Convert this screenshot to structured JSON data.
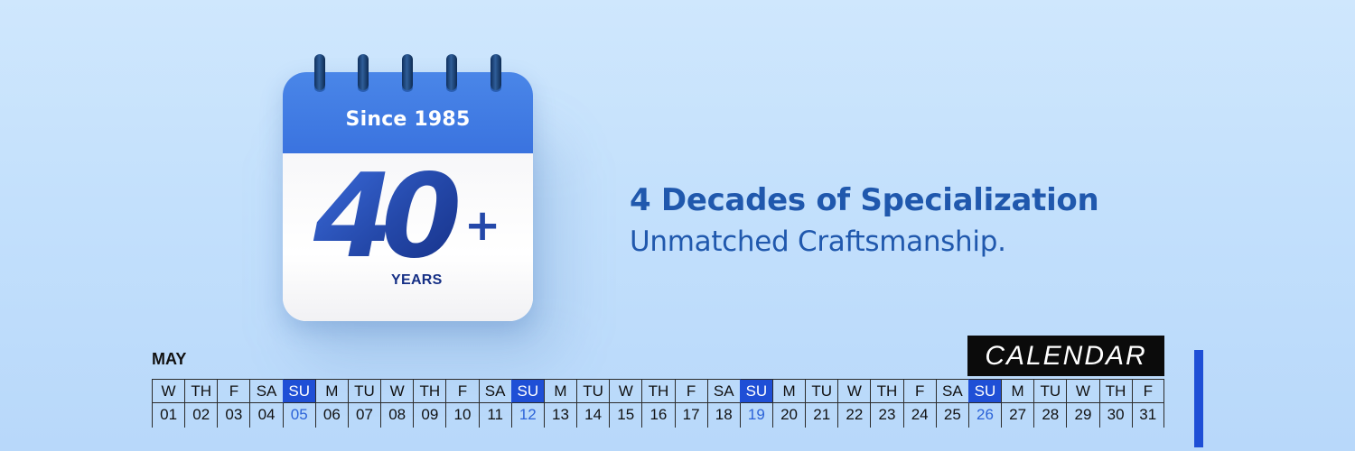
{
  "calendar_graphic": {
    "since_label": "Since 1985",
    "big_number": "40",
    "plus_sign": "+",
    "years_label": "YEARS",
    "ring_icon": "binder-ring-icon",
    "colors": {
      "header": "#3a73df",
      "number": "#2448a9"
    }
  },
  "headline": {
    "title": "4 Decades of Specialization",
    "subtitle": "Unmatched Craftsmanship."
  },
  "calendar_strip": {
    "month": "MAY",
    "badge": "CALENDAR",
    "days": [
      {
        "day": "W",
        "date": "01",
        "sunday": false
      },
      {
        "day": "TH",
        "date": "02",
        "sunday": false
      },
      {
        "day": "F",
        "date": "03",
        "sunday": false
      },
      {
        "day": "SA",
        "date": "04",
        "sunday": false
      },
      {
        "day": "SU",
        "date": "05",
        "sunday": true
      },
      {
        "day": "M",
        "date": "06",
        "sunday": false
      },
      {
        "day": "TU",
        "date": "07",
        "sunday": false
      },
      {
        "day": "W",
        "date": "08",
        "sunday": false
      },
      {
        "day": "TH",
        "date": "09",
        "sunday": false
      },
      {
        "day": "F",
        "date": "10",
        "sunday": false
      },
      {
        "day": "SA",
        "date": "11",
        "sunday": false
      },
      {
        "day": "SU",
        "date": "12",
        "sunday": true
      },
      {
        "day": "M",
        "date": "13",
        "sunday": false
      },
      {
        "day": "TU",
        "date": "14",
        "sunday": false
      },
      {
        "day": "W",
        "date": "15",
        "sunday": false
      },
      {
        "day": "TH",
        "date": "16",
        "sunday": false
      },
      {
        "day": "F",
        "date": "17",
        "sunday": false
      },
      {
        "day": "SA",
        "date": "18",
        "sunday": false
      },
      {
        "day": "SU",
        "date": "19",
        "sunday": true
      },
      {
        "day": "M",
        "date": "20",
        "sunday": false
      },
      {
        "day": "TU",
        "date": "21",
        "sunday": false
      },
      {
        "day": "W",
        "date": "22",
        "sunday": false
      },
      {
        "day": "TH",
        "date": "23",
        "sunday": false
      },
      {
        "day": "F",
        "date": "24",
        "sunday": false
      },
      {
        "day": "SA",
        "date": "25",
        "sunday": false
      },
      {
        "day": "SU",
        "date": "26",
        "sunday": true
      },
      {
        "day": "M",
        "date": "27",
        "sunday": false
      },
      {
        "day": "TU",
        "date": "28",
        "sunday": false
      },
      {
        "day": "W",
        "date": "29",
        "sunday": false
      },
      {
        "day": "TH",
        "date": "30",
        "sunday": false
      },
      {
        "day": "F",
        "date": "31",
        "sunday": false
      }
    ],
    "colors": {
      "sunday_highlight": "#1f4fd6",
      "sunday_date_text": "#2c63d8",
      "badge_background": "#0b0b0b"
    }
  }
}
